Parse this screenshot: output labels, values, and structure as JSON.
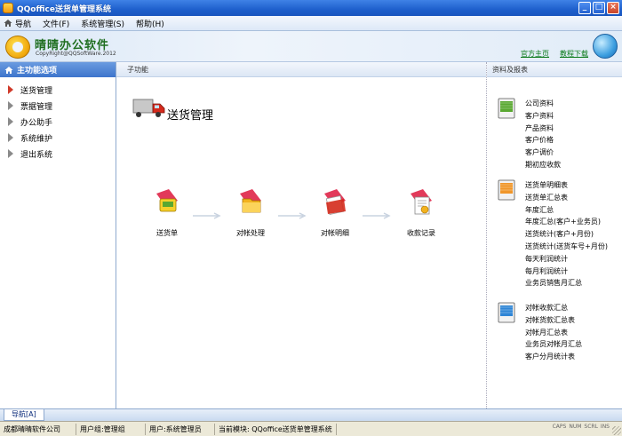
{
  "window": {
    "title": "QQoffice送货单管理系统",
    "min": "_",
    "max": "□",
    "close": "×"
  },
  "menu": [
    {
      "label": "导航",
      "icon": "home-icon"
    },
    {
      "label": "文件(F)"
    },
    {
      "label": "系统管理(S)"
    },
    {
      "label": "帮助(H)"
    }
  ],
  "banner": {
    "logo_title": "晴晴办公软件",
    "logo_sub": "CopyRight@QQSoftWare.2012",
    "links": [
      "官方主页",
      "教程下载"
    ]
  },
  "sidebar": {
    "title": "主功能选项",
    "items": [
      {
        "label": "送货管理",
        "active": true
      },
      {
        "label": "票据管理"
      },
      {
        "label": "办公助手"
      },
      {
        "label": "系统维护"
      },
      {
        "label": "退出系统"
      }
    ]
  },
  "center": {
    "header": "子功能",
    "title": "送货管理",
    "flow": [
      {
        "label": "送货单",
        "icon": "delivery-note-icon"
      },
      {
        "label": "对帐处理",
        "icon": "reconcile-folder-icon"
      },
      {
        "label": "对帐明细",
        "icon": "reconcile-detail-icon"
      },
      {
        "label": "收款记录",
        "icon": "payment-record-icon"
      }
    ]
  },
  "right": {
    "header": "资料及报表",
    "groups": [
      {
        "icon": "green-binder-icon",
        "color": "#5aa832",
        "items": [
          "公司资料",
          "客户资料",
          "产品资料",
          "客户价格",
          "客户调价",
          "期初应收款"
        ]
      },
      {
        "icon": "orange-binder-icon",
        "color": "#f0962a",
        "items": [
          "送货单明细表",
          "送货单汇总表",
          "年度汇总",
          "年度汇总(客户+业务员)",
          "送货统计(客户+月份)",
          "送货统计(送货车号+月份)",
          "每天利润统计",
          "每月利润统计",
          "业务员销售月汇总"
        ]
      },
      {
        "icon": "blue-binder-icon",
        "color": "#2f86d6",
        "items": [
          "对帐收款汇总",
          "对帐货款汇总表",
          "对帐月汇总表",
          "业务员对帐月汇总",
          "客户分月统计表"
        ]
      }
    ]
  },
  "tabs": {
    "nav_tab": "导航[A]"
  },
  "status": {
    "company": "成都晴晴软件公司",
    "group": "用户组:管理组",
    "user": "用户:系统管理员",
    "module": "当前模块: QQoffice送货单管理系统",
    "flags": [
      "CAPS",
      "NUM",
      "SCRL",
      "INS"
    ]
  }
}
